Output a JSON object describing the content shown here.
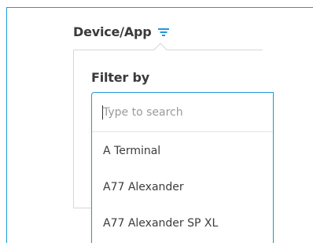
{
  "column": {
    "title": "Device/App",
    "filter_icon": "filter-icon"
  },
  "filter_popover": {
    "heading": "Filter by",
    "search": {
      "placeholder": "Type to search",
      "value": ""
    },
    "options": [
      {
        "label": "A Terminal"
      },
      {
        "label": "A77 Alexander"
      },
      {
        "label": "A77 Alexander SP XL"
      }
    ]
  },
  "colors": {
    "accent": "#1e9ad6",
    "text": "#3a3a3a",
    "border": "#d7d7d7"
  }
}
